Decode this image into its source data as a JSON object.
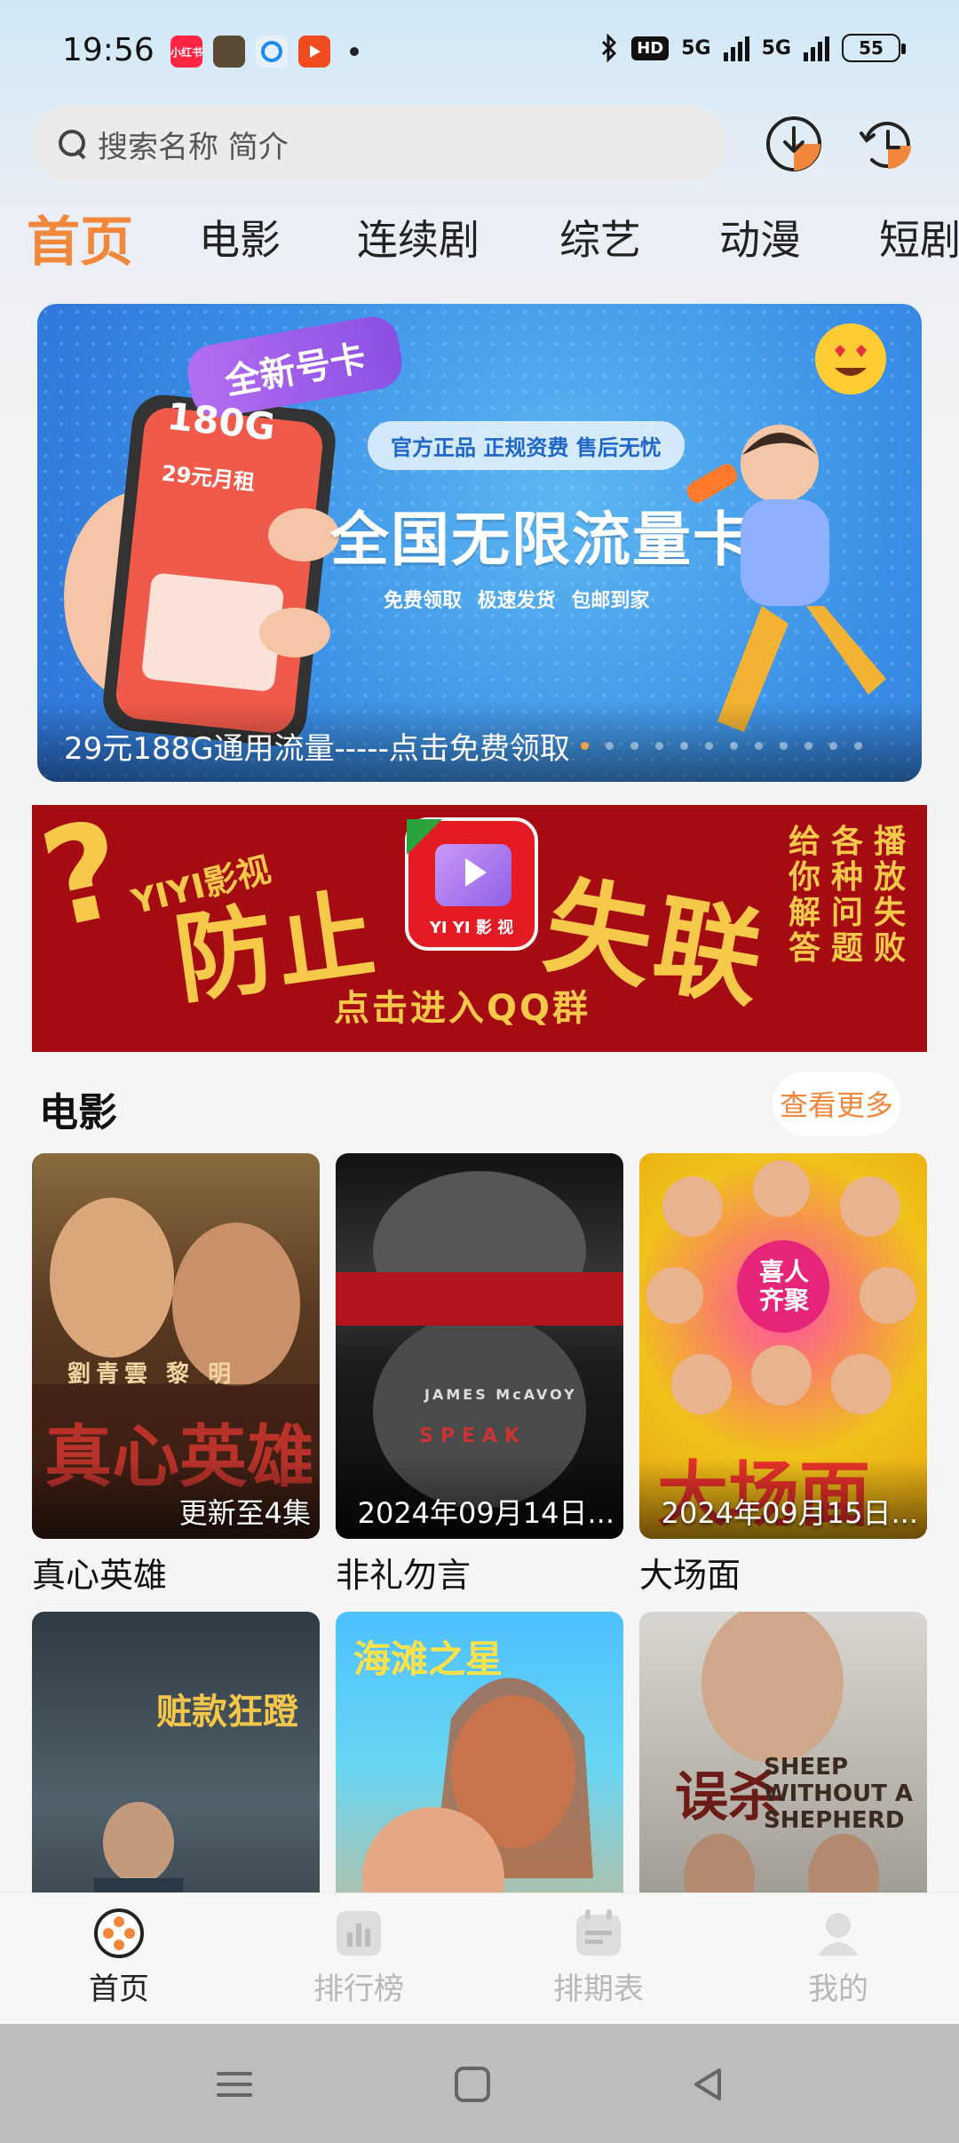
{
  "status_bar": {
    "time": "19:56",
    "app_badge": "小红书",
    "hd": "HD",
    "net1": "5G",
    "net2": "5G",
    "battery": "55"
  },
  "search": {
    "placeholder": "搜索名称 简介"
  },
  "tabs": [
    {
      "label": "首页",
      "active": true
    },
    {
      "label": "电影"
    },
    {
      "label": "连续剧"
    },
    {
      "label": "综艺"
    },
    {
      "label": "动漫"
    },
    {
      "label": "短剧"
    }
  ],
  "banner": {
    "tag": "全新号卡",
    "official": "官方正品 正规资费 售后无忧",
    "title": "全国无限流量卡",
    "subtitle": "免费领取 极速发货 包邮到家",
    "caption": "29元188G通用流量-----点击免费领取",
    "phone_amount": "180G",
    "phone_price": "29元月租"
  },
  "group_banner": {
    "brand": "YIYI影视",
    "left_text": "防止",
    "right_text": "失联",
    "join": "点击进入QQ群",
    "logo_label": "YI YI 影 视",
    "logo_corner": "影视",
    "side_cols": [
      [
        "播",
        "放",
        "失",
        "败"
      ],
      [
        "各",
        "种",
        "问",
        "题"
      ],
      [
        "给",
        "你",
        "解",
        "答"
      ]
    ]
  },
  "section": {
    "title": "电影",
    "more": "查看更多"
  },
  "movies": [
    {
      "title": "真心英雄",
      "badge": "更新至4集"
    },
    {
      "title": "非礼勿言",
      "badge": "2024年09月14日..."
    },
    {
      "title": "大场面",
      "badge": "2024年09月15日..."
    },
    {
      "title": "",
      "badge": ""
    },
    {
      "title": "",
      "badge": ""
    },
    {
      "title": "",
      "badge": ""
    }
  ],
  "poster_texts": {
    "p1_cast": "劉青雲  黎  明",
    "p1_title": "真心英雄",
    "p2_actor": "JAMES McAVOY",
    "p2_title": "SPEAK",
    "p3_tag": "喜人齐聚",
    "p3_title": "大场面",
    "p4_title": "赃款狂蹬",
    "p5_title": "海滩之星",
    "p6_title": "误杀",
    "p6_en": "SHEEP WITHOUT A SHEPHERD"
  },
  "bottom_nav": [
    {
      "label": "首页",
      "active": true
    },
    {
      "label": "排行榜"
    },
    {
      "label": "排期表"
    },
    {
      "label": "我的"
    }
  ],
  "colors": {
    "accent": "#f0873a",
    "banner_red": "#a50c12",
    "gold": "#f6c94a"
  }
}
